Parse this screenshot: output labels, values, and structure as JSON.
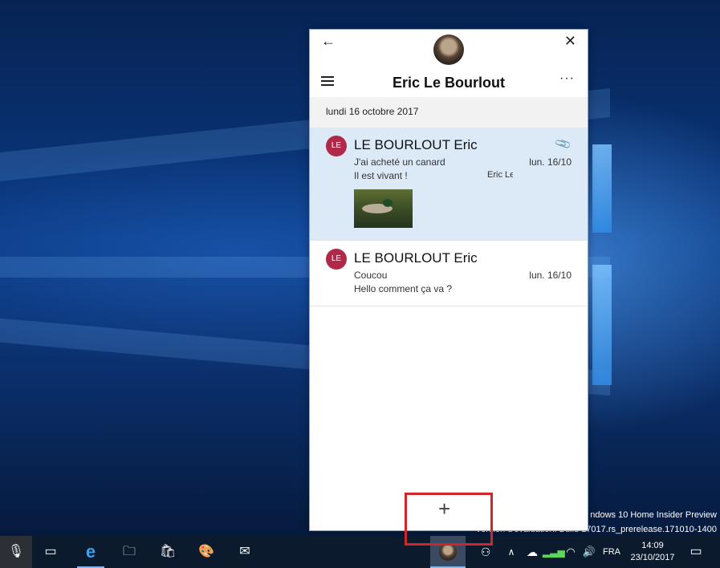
{
  "desktop": {
    "watermark_line1": "ndows 10 Home Insider Preview",
    "watermark_line2": "Version d'évaluation. Build 17017.rs_prerelease.171010-1400"
  },
  "app": {
    "title": "Eric Le Bourlout",
    "back_icon": "←",
    "close_icon": "✕",
    "more_icon": "···",
    "date_header": "lundi 16 octobre 2017",
    "messages": [
      {
        "avatar_initials": "LE",
        "sender": "LE BOURLOUT Eric",
        "subject": "J'ai acheté un canard",
        "preview": "Il est vivant !",
        "preview_tail": "Eric Le",
        "date": "lun. 16/10",
        "has_attachment": true
      },
      {
        "avatar_initials": "LE",
        "sender": "LE BOURLOUT Eric",
        "subject": "Coucou",
        "preview": "Hello comment ça va ?",
        "date": "lun. 16/10",
        "has_attachment": false
      }
    ],
    "compose_icon": "+"
  },
  "taskbar": {
    "mic_icon": "🎙",
    "taskview_icon": "▭",
    "edge_icon": "e",
    "explorer_icon": "🗀",
    "store_icon": "🛍",
    "paint_icon": "🎨",
    "mail_icon": "✉",
    "people_icon": "⚇",
    "chevron_icon": "∧",
    "cloud_icon": "☁",
    "signal_icon": "▂▃▅",
    "wifi_icon": "◠",
    "volume_icon": "🔊",
    "language": "FRA",
    "time": "14:09",
    "date": "23/10/2017",
    "notification_icon": "▭"
  },
  "colors": {
    "accent": "#0078d7",
    "avatar_bg": "#b0294a",
    "selected_bg": "#dceaf8",
    "highlight": "#d0262b"
  }
}
